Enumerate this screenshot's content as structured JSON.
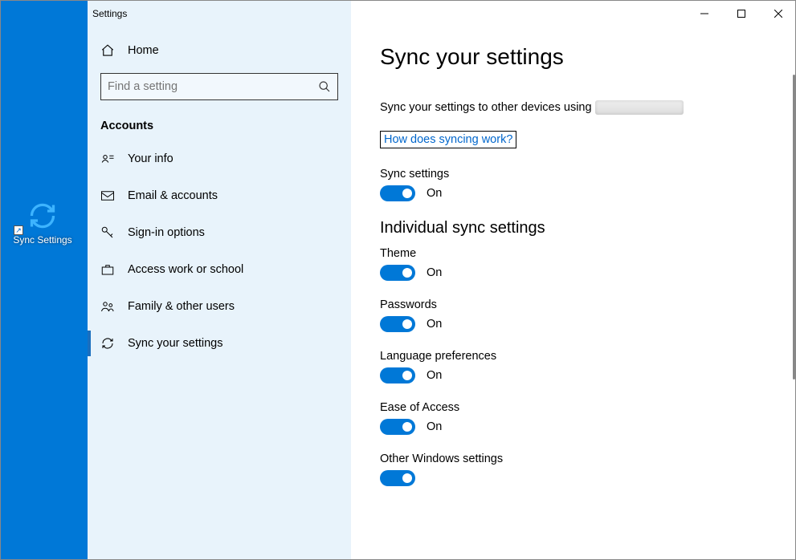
{
  "desktop": {
    "shortcut_label": "Sync Settings"
  },
  "window": {
    "title": "Settings"
  },
  "sidebar": {
    "home": "Home",
    "search_placeholder": "Find a setting",
    "section": "Accounts",
    "items": [
      {
        "label": "Your info"
      },
      {
        "label": "Email & accounts"
      },
      {
        "label": "Sign-in options"
      },
      {
        "label": "Access work or school"
      },
      {
        "label": "Family & other users"
      },
      {
        "label": "Sync your settings"
      }
    ]
  },
  "main": {
    "title": "Sync your settings",
    "description": "Sync your settings to other devices using",
    "help_link": "How does syncing work?",
    "sync_settings_label": "Sync settings",
    "on_label": "On",
    "individual_header": "Individual sync settings",
    "settings": [
      {
        "label": "Theme",
        "state": "On"
      },
      {
        "label": "Passwords",
        "state": "On"
      },
      {
        "label": "Language preferences",
        "state": "On"
      },
      {
        "label": "Ease of Access",
        "state": "On"
      },
      {
        "label": "Other Windows settings",
        "state": "On"
      }
    ]
  }
}
